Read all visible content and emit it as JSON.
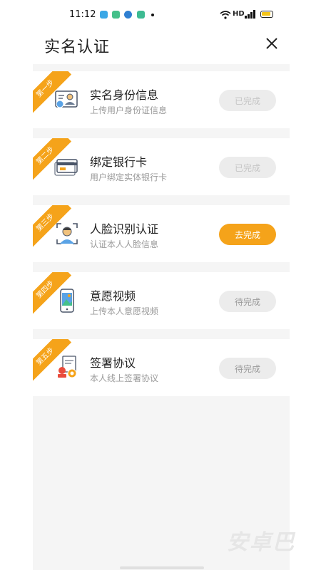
{
  "status_bar": {
    "time": "11:12",
    "network": "HD"
  },
  "header": {
    "title": "实名认证"
  },
  "steps": [
    {
      "badge": "第一步",
      "title": "实名身份信息",
      "subtitle": "上传用户身份证信息",
      "button": "已完成",
      "state": "done"
    },
    {
      "badge": "第二步",
      "title": "绑定银行卡",
      "subtitle": "用户绑定实体银行卡",
      "button": "已完成",
      "state": "done"
    },
    {
      "badge": "第三步",
      "title": "人脸识别认证",
      "subtitle": "认证本人人脸信息",
      "button": "去完成",
      "state": "active"
    },
    {
      "badge": "第四步",
      "title": "意愿视频",
      "subtitle": "上传本人意愿视频",
      "button": "待完成",
      "state": "pending"
    },
    {
      "badge": "第五步",
      "title": "签署协议",
      "subtitle": "本人线上签署协议",
      "button": "待完成",
      "state": "pending"
    }
  ],
  "watermark": "安卓巴",
  "colors": {
    "accent": "#f5a31a",
    "panel_bg": "#f5f5f5",
    "muted_text": "#9a9a9a"
  }
}
